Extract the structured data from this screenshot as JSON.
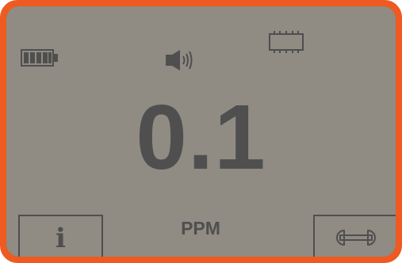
{
  "device": {
    "frame_color": "#ee5a21",
    "screen_color": "#908b83",
    "ink_color": "#4f4f4f"
  },
  "status_icons": [
    "battery-full-icon",
    "speaker-volume-icon",
    "memory-chip-icon"
  ],
  "reading": {
    "value": "0.1",
    "unit": "PPM"
  },
  "buttons": {
    "info": {
      "glyph": "i",
      "icon": "info-icon"
    },
    "tools": {
      "icon": "wrench-icon"
    }
  }
}
